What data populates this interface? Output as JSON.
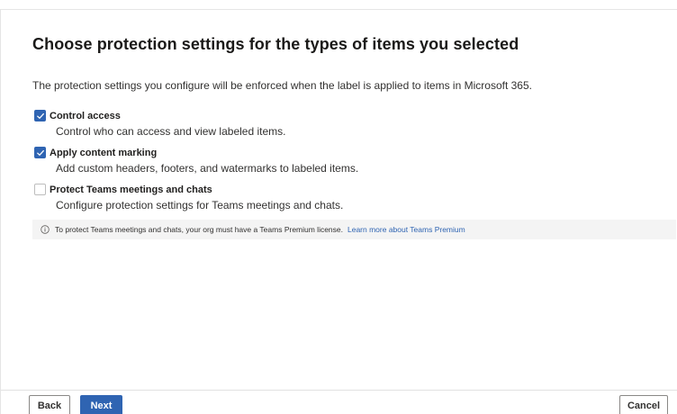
{
  "page": {
    "title": "Choose protection settings for the types of items you selected",
    "description": "The protection settings you configure will be enforced when the label is applied to items in Microsoft 365."
  },
  "options": [
    {
      "label": "Control access",
      "description": "Control who can access and view labeled items.",
      "checked": true
    },
    {
      "label": "Apply content marking",
      "description": "Add custom headers, footers, and watermarks to labeled items.",
      "checked": true
    },
    {
      "label": "Protect Teams meetings and chats",
      "description": "Configure protection settings for Teams meetings and chats.",
      "checked": false
    }
  ],
  "info": {
    "icon": "info-icon",
    "text": "To protect Teams meetings and chats, your org must have a Teams Premium license.",
    "link_text": "Learn more about Teams Premium"
  },
  "footer": {
    "back_label": "Back",
    "next_label": "Next",
    "cancel_label": "Cancel"
  },
  "colors": {
    "accent": "#2f64b2",
    "info_bg": "#f4f4f4"
  }
}
